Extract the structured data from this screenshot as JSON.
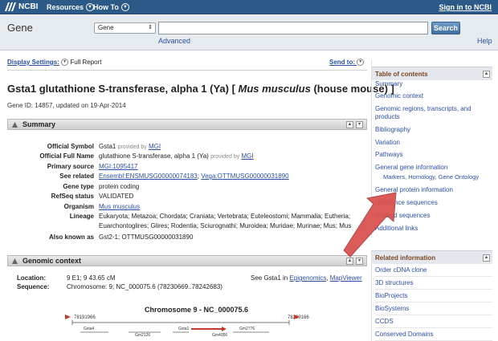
{
  "topbar": {
    "logo": "NCBI",
    "resources": "Resources",
    "how_to": "How To",
    "sign_in": "Sign in to NCBI",
    "colors": {
      "bar": "#2c5a88",
      "link": "#2a4fa8"
    }
  },
  "search": {
    "database_title": "Gene",
    "database_select": "Gene",
    "query": "",
    "search_button": "Search",
    "advanced": "Advanced",
    "help": "Help"
  },
  "display": {
    "settings_label": "Display Settings:",
    "settings_value": "Full Report",
    "send_to": "Send to:"
  },
  "gene": {
    "title_main": "Gsta1 glutathione S-transferase, alpha 1 (Ya) [ ",
    "title_species": "Mus musculus",
    "title_tail": " (house mouse) ]",
    "id_line": "Gene ID: 14857, updated on 19-Apr-2014"
  },
  "summary": {
    "header": "Summary",
    "rows": [
      {
        "label": "Official Symbol",
        "value": "Gsta1",
        "provided": "provided by",
        "source": "MGI"
      },
      {
        "label": "Official Full Name",
        "value": "glutathione S-transferase, alpha 1 (Ya)",
        "provided": "provided by",
        "source": "MGI"
      },
      {
        "label": "Primary source",
        "link": "MGI:1095417"
      },
      {
        "label": "See related",
        "link": "Ensembl:ENSMUSG00000074183",
        "sep": "; ",
        "link2": "Vega:OTTMUSG00000031890"
      },
      {
        "label": "Gene type",
        "value": "protein coding"
      },
      {
        "label": "RefSeq status",
        "value": "VALIDATED"
      },
      {
        "label": "Organism",
        "link": "Mus musculus"
      },
      {
        "label": "Lineage",
        "value": "Eukaryota; Metazoa; Chordata; Craniata; Vertebrata; Euteleostomi; Mammalia; Eutheria;",
        "value2": "Euarchontoglires; Glires; Rodentia; Sciurognathi; Muroidea; Muridae; Murinae; Mus; Mus"
      },
      {
        "label": "Also known as",
        "value": "Gst2-1; OTTMUSG00000031890"
      }
    ]
  },
  "genomic": {
    "header": "Genomic context",
    "location_label": "Location:",
    "location_value": "9 E1; 9 43.65 cM",
    "sequence_label": "Sequence:",
    "sequence_value": "Chromosome: 9; NC_000075.6 (78230669..78242683)",
    "see_prefix": "See Gsta1 in ",
    "see_link1": "Epigenomics",
    "see_sep": ", ",
    "see_link2": "MapViewer",
    "chrom_title": "Chromosome 9 - NC_000075.6",
    "left_coord": "78191966",
    "right_coord": "78269166",
    "genes": [
      "Gsta4",
      "Gm2126",
      "Gsta1",
      "Gm4956",
      "Gm2776"
    ]
  },
  "toc": {
    "header": "Table of contents",
    "items": [
      "Summary",
      "Genomic context",
      "Genomic regions, transcripts, and",
      "products",
      "Bibliography",
      "Variation",
      "Pathways",
      "General gene information",
      "General protein information",
      "Reference sequences",
      "Related sequences",
      "Additional links"
    ],
    "subitems": [
      "Markers",
      "Homology",
      "Gene Ontology"
    ]
  },
  "related": {
    "header": "Related information",
    "items": [
      "Order cDNA clone",
      "3D structures",
      "BioProjects",
      "BioSystems",
      "CCDS",
      "Conserved Domains"
    ]
  },
  "annotation": {
    "arrow_color": "#d9534f"
  }
}
